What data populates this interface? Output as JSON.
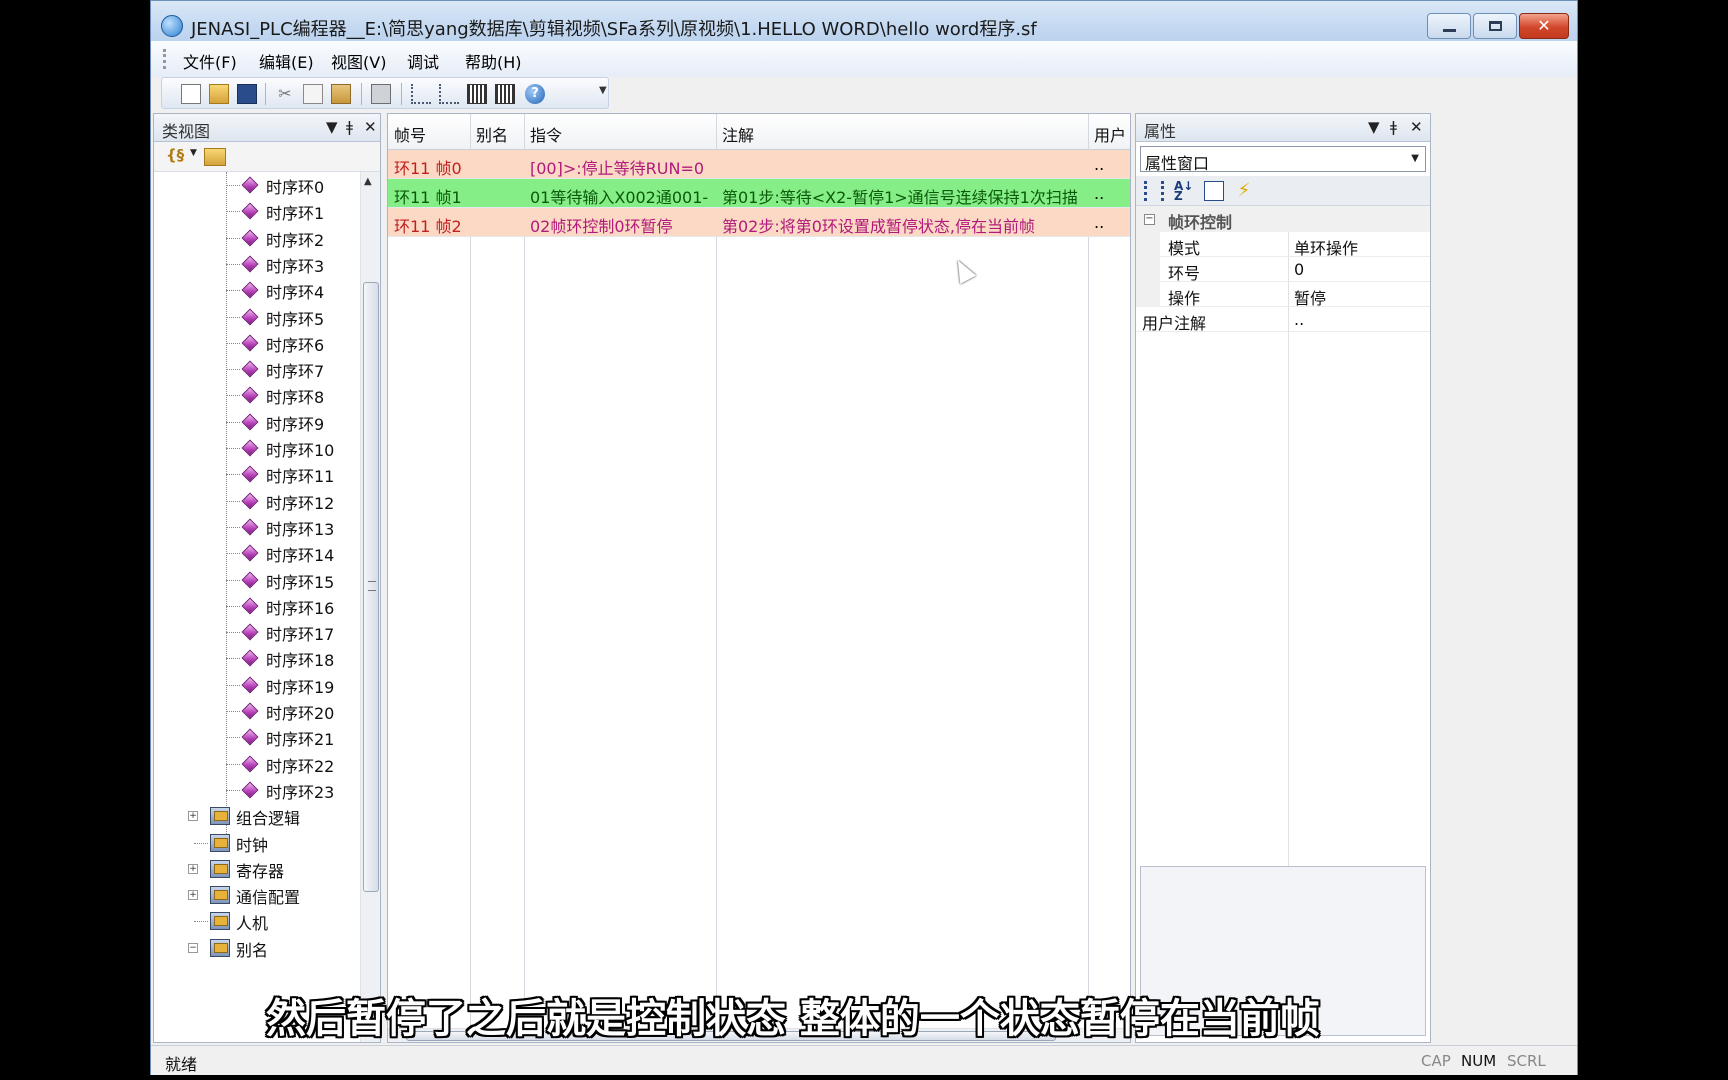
{
  "window": {
    "title": "JENASI_PLC编程器__E:\\简思yang数据库\\剪辑视频\\SFa系列\\原视频\\1.HELLO WORD\\hello word程序.sf"
  },
  "menu": {
    "file": "文件(F)",
    "edit": "编辑(E)",
    "view": "视图(V)",
    "debug": "调试",
    "help": "帮助(H)"
  },
  "left_panel": {
    "title": "类视图",
    "timing_rings": [
      "时序环0",
      "时序环1",
      "时序环2",
      "时序环3",
      "时序环4",
      "时序环5",
      "时序环6",
      "时序环7",
      "时序环8",
      "时序环9",
      "时序环10",
      "时序环11",
      "时序环12",
      "时序环13",
      "时序环14",
      "时序环15",
      "时序环16",
      "时序环17",
      "时序环18",
      "时序环19",
      "时序环20",
      "时序环21",
      "时序环22",
      "时序环23"
    ],
    "groups": [
      "组合逻辑",
      "时钟",
      "寄存器",
      "通信配置",
      "人机",
      "别名"
    ]
  },
  "grid": {
    "columns": [
      "帧号",
      "别名",
      "指令",
      "注解",
      "用户"
    ],
    "rows": [
      {
        "frame": "环11 帧0",
        "alias": "",
        "instruction": "[00]>:停止等待RUN=0",
        "note": "",
        "user": ".."
      },
      {
        "frame": "环11 帧1",
        "alias": "",
        "instruction": "01等待输入X002通001-",
        "note": "第01步:等待<X2-暂停1>通信号连续保持1次扫描",
        "user": ".."
      },
      {
        "frame": "环11 帧2",
        "alias": "",
        "instruction": "02帧环控制0环暂停",
        "note": "第02步:将第0环设置成暂停状态,停在当前帧",
        "user": ".."
      }
    ]
  },
  "right_panel": {
    "title": "属性",
    "combo_value": "属性窗口",
    "category": "帧环控制",
    "category_toggle": "−",
    "props": [
      {
        "name": "模式",
        "value": "单环操作"
      },
      {
        "name": "环号",
        "value": "0"
      },
      {
        "name": "操作",
        "value": "暂停"
      }
    ],
    "extra_prop": {
      "name": "用户注解",
      "value": ".."
    }
  },
  "statusbar": {
    "text": "就绪",
    "cap": "CAP",
    "num": "NUM",
    "scrl": "SCRL"
  },
  "subtitle": "然后暂停了之后就是控制状态 整体的一个状态暂停在当前帧",
  "colors": {
    "row_pink": "#fcd9c4",
    "row_green": "#86ee86",
    "text_red": "#c02020",
    "text_magenta": "#b01a7a"
  }
}
